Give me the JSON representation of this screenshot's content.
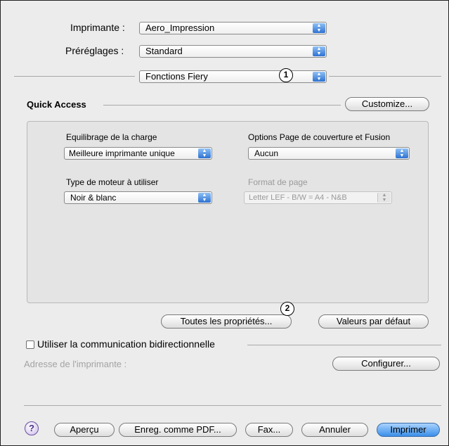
{
  "printer": {
    "label": "Imprimante :",
    "value": "Aero_Impression"
  },
  "presets": {
    "label": "Préréglages :",
    "value": "Standard"
  },
  "panel": {
    "value": "Fonctions Fiery"
  },
  "markers": {
    "one": "1",
    "two": "2"
  },
  "quick_access": {
    "title": "Quick Access",
    "customize_button": "Customize...",
    "load_balance": {
      "label": "Equilibrage de la charge",
      "value": "Meilleure imprimante unique"
    },
    "cover_options": {
      "label": "Options Page de couverture et Fusion",
      "value": "Aucun"
    },
    "engine_type": {
      "label": "Type de moteur à utiliser",
      "value": "Noir & blanc"
    },
    "page_format": {
      "label": "Format de page",
      "value": "Letter LEF - B/W = A4 - N&B"
    }
  },
  "buttons": {
    "all_properties": "Toutes les propriétés...",
    "defaults": "Valeurs par défaut",
    "configure": "Configurer...",
    "help": "?",
    "preview": "Aperçu",
    "save_pdf": "Enreg. comme PDF...",
    "fax": "Fax...",
    "cancel": "Annuler",
    "print": "Imprimer"
  },
  "bidirectional": {
    "label": "Utiliser la communication bidirectionnelle",
    "checked": false
  },
  "printer_address": {
    "label": "Adresse de l'imprimante :"
  },
  "icons": {
    "popup_arrows": "up-down-arrows-icon",
    "help": "help-icon"
  },
  "colors": {
    "accent_blue": "#2d72d2",
    "primary_button": "#3a8ee8",
    "window_bg": "#ececec"
  }
}
